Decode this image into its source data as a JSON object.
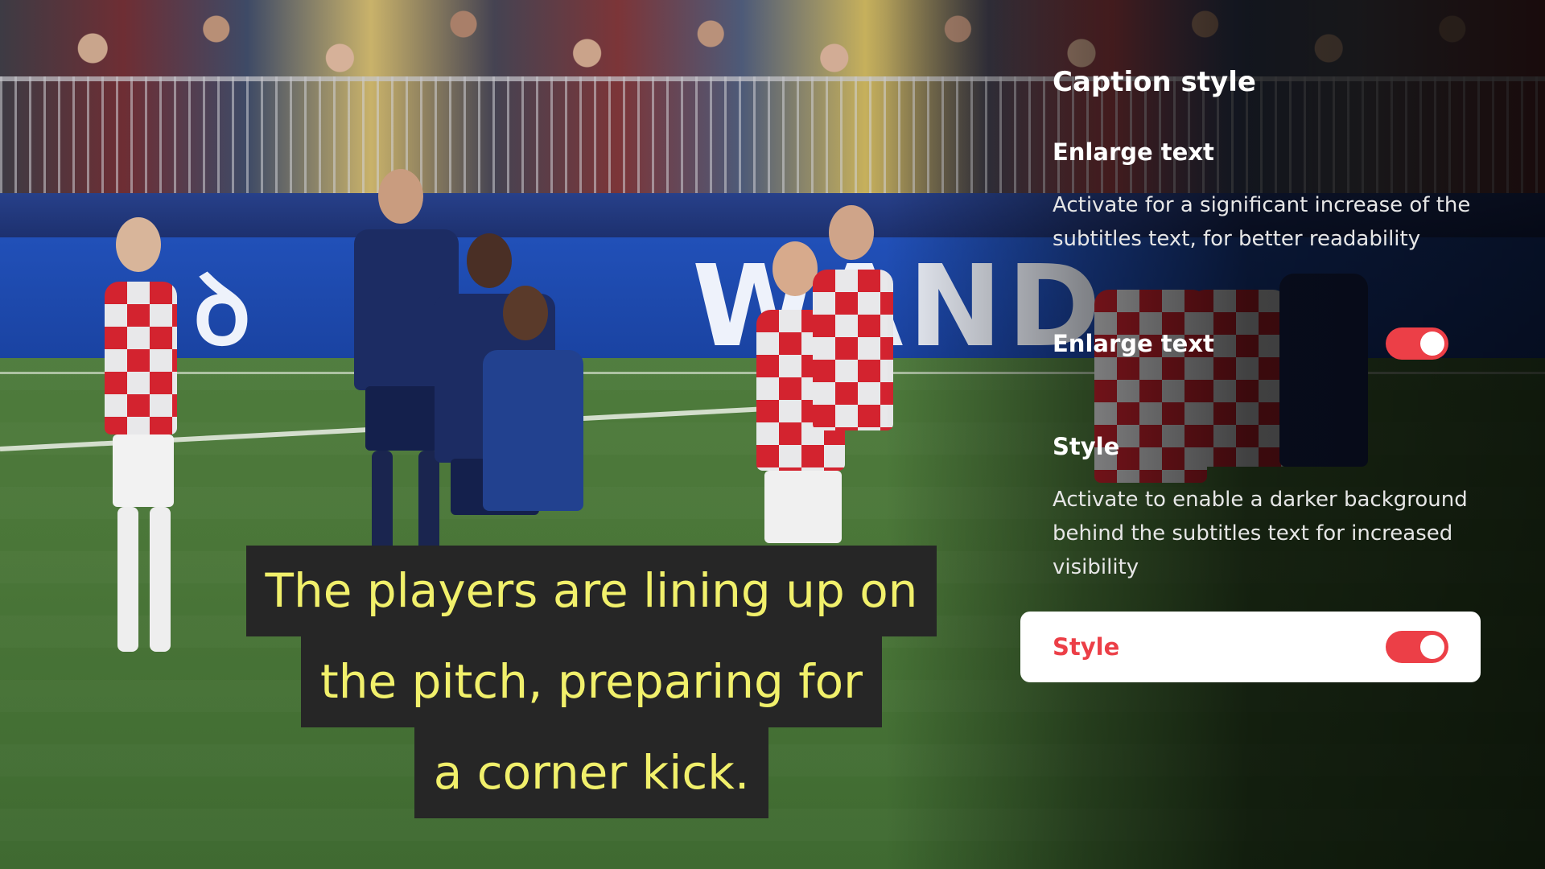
{
  "video": {
    "description_icon": "video-frame",
    "ad_board_text": "WAND",
    "captions": [
      "The players are lining up on",
      "the pitch, preparing for",
      "a corner kick."
    ]
  },
  "panel": {
    "title": "Caption style",
    "sections": [
      {
        "heading": "Enlarge text",
        "description": "Activate for a significant increase of the subtitles text, for better readability",
        "toggle_label": "Enlarge text",
        "toggle_on": true,
        "focused": false
      },
      {
        "heading": "Style",
        "description": "Activate to enable a darker background behind the subtitles text for increased visibility",
        "toggle_label": "Style",
        "toggle_on": true,
        "focused": true
      }
    ]
  },
  "colors": {
    "accent": "#ec3f47",
    "caption_text": "#f1f06b",
    "caption_background": "#262626"
  }
}
